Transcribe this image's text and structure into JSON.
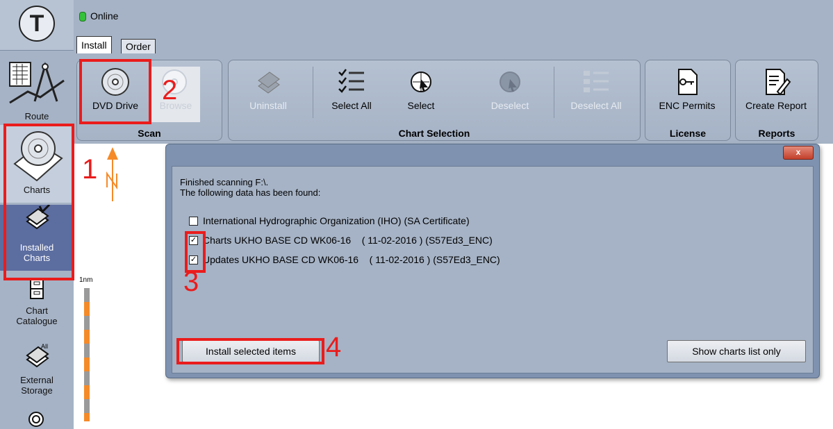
{
  "sidebar": {
    "items": [
      {
        "label": "Route"
      },
      {
        "label": "Charts"
      },
      {
        "label": "Installed Charts"
      },
      {
        "label": "Chart Catalogue"
      },
      {
        "label": "External Storage"
      }
    ]
  },
  "status": {
    "text": "Online",
    "color": "#35c13a"
  },
  "tabs": [
    {
      "label": "Install"
    },
    {
      "label": "Order"
    }
  ],
  "ribbon": {
    "groups": [
      {
        "label": "Scan",
        "buttons": [
          {
            "label": "DVD Drive"
          },
          {
            "label": "Browse"
          }
        ]
      },
      {
        "label": "Chart Selection",
        "buttons": [
          {
            "label": "Uninstall"
          },
          {
            "label": "Select All"
          },
          {
            "label": "Select"
          },
          {
            "label": "Deselect"
          },
          {
            "label": "Deselect All"
          }
        ]
      },
      {
        "label": "License",
        "buttons": [
          {
            "label": "ENC Permits"
          }
        ]
      },
      {
        "label": "Reports",
        "buttons": [
          {
            "label": "Create Report"
          }
        ]
      }
    ]
  },
  "map": {
    "scale_label": "1nm"
  },
  "dialog": {
    "message_line1": "Finished scanning F:\\.",
    "message_line2": "The following data has been found:",
    "items": [
      {
        "label": "International Hydrographic Organization (IHO) (SA Certificate)",
        "checked": false
      },
      {
        "label": "Charts UKHO BASE CD WK06-16    ( 11-02-2016 ) (S57Ed3_ENC)",
        "checked": true
      },
      {
        "label": "Updates UKHO BASE CD WK06-16    ( 11-02-2016 ) (S57Ed3_ENC)",
        "checked": true
      }
    ],
    "install_button": "Install selected items",
    "show_list_button": "Show charts list only",
    "close": "x"
  },
  "annotations": [
    "1",
    "2",
    "3",
    "4"
  ],
  "colors": {
    "annotation": "#ea1c1c",
    "selected": "#5c6da0",
    "panel": "#a6b3c6"
  }
}
